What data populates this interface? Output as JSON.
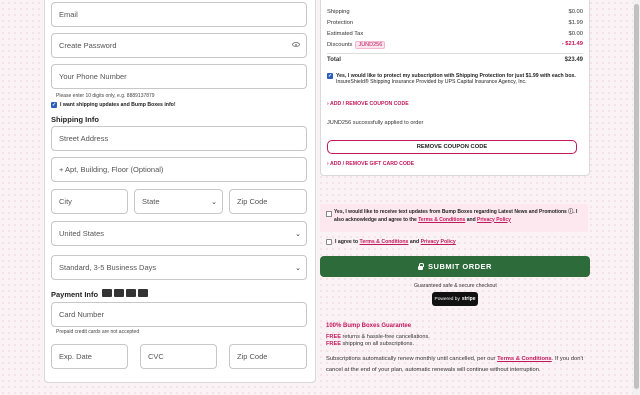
{
  "form": {
    "email_placeholder": "Email",
    "password_placeholder": "Create Password",
    "phone_placeholder": "Your Phone Number",
    "phone_hint": "Please enter 10 digits only, e.g. 8889137879",
    "shipping_updates_label": "I want shipping updates and Bump Boxes info!",
    "shipping_info_title": "Shipping Info",
    "street_placeholder": "Street Address",
    "apt_placeholder": "+ Apt, Building, Floor (Optional)",
    "city_placeholder": "City",
    "state_value": "State",
    "zip_placeholder": "Zip Code",
    "country_value": "United States",
    "shipping_method_value": "Standard, 3-5 Business Days",
    "payment_info_title": "Payment Info",
    "card_number_placeholder": "Card Number",
    "prepaid_note": "Prepaid credit cards are not accepted",
    "exp_placeholder": "Exp. Date",
    "cvc_placeholder": "CVC",
    "card_zip_placeholder": "Zip Code"
  },
  "summary": {
    "rows": [
      {
        "label": "Shipping",
        "value": "$0.00"
      },
      {
        "label": "Protection",
        "value": "$1.99"
      },
      {
        "label": "Estimated Tax",
        "value": "$0.00"
      }
    ],
    "discount_label": "Discounts",
    "discount_code": "JUND256",
    "discount_value": "- $21.49",
    "total_label": "Total",
    "total_value": "$23.49",
    "protection_text": "Yes, I would like to protect my subscription with Shipping Protection for just $1.99 with each box.",
    "protection_subtext": "InsureShield® Shipping Insurance Provided by UPS Capital Insurance Agency, Inc.",
    "coupon_toggle": "ADD / REMOVE COUPON CODE",
    "coupon_applied": "JUND256 successfully applied to order",
    "remove_coupon_button": "REMOVE COUPON CODE",
    "gift_card_toggle": "ADD / REMOVE GIFT CARD CODE"
  },
  "sms": {
    "text_a": "Yes, I would like to receive text updates from Bump Boxes regarding Latest News and Promotions",
    "text_b": ". I also acknowledge and agree to the",
    "terms": "Terms & Conditions",
    "and": "and",
    "privacy": "Privacy Policy"
  },
  "agree": {
    "prefix": "I agree to",
    "terms": "Terms & Conditions",
    "and": "and",
    "privacy": "Privacy Policy"
  },
  "submit_label": "SUBMIT ORDER",
  "secure_text": "Guaranteed safe & secure checkout",
  "stripe": {
    "powered": "Powered by",
    "brand": "stripe"
  },
  "guarantee": {
    "title": "100% Bump Boxes Guarantee",
    "line1_bold": "FREE",
    "line1": "returns & hassle-free cancellations.",
    "line2_bold": "FREE",
    "line2": "shipping on all subscriptions."
  },
  "renewal": {
    "text_a": "Subscriptions automatically renew monthly until cancelled, per our",
    "link": "Terms & Conditions",
    "text_b": ". If you don't cancel at the end of your plan, automatic renewals will continue without interruption."
  },
  "colors": {
    "accent": "#c2185b",
    "submit": "#2e6b3a",
    "sms_bg": "#fde8ef"
  }
}
